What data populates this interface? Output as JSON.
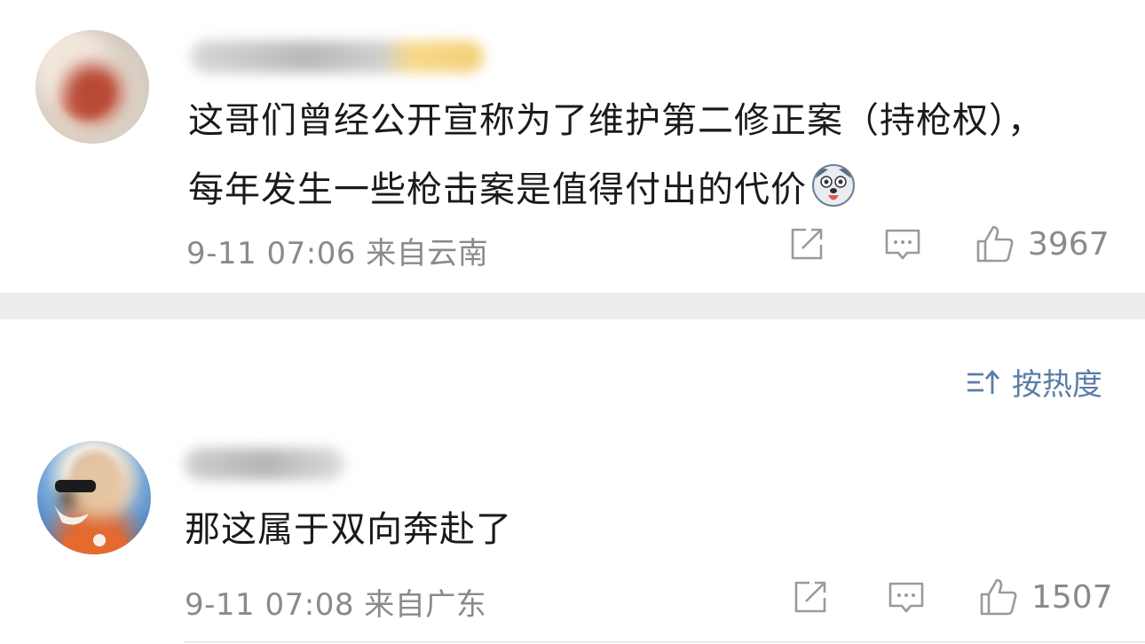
{
  "comments": [
    {
      "content": "这哥们曾经公开宣称为了维护第二修正案（持枪权），每年发生一些枪击案是值得付出的代价",
      "emoji": "dog-face-emoji",
      "time": "9-11 07:06",
      "location": "来自云南",
      "likes": "3967"
    },
    {
      "content": "那这属于双向奔赴了",
      "time": "9-11 07:08",
      "location": "来自广东",
      "likes": "1507"
    }
  ],
  "sort": {
    "label": "按热度",
    "icon": "sort-icon"
  },
  "icons": {
    "share": "share-icon",
    "comment": "comment-icon",
    "like": "thumbs-up-icon"
  },
  "colors": {
    "meta": "#8a8a8a",
    "sort": "#5b7ea6",
    "separator": "#ececec"
  }
}
